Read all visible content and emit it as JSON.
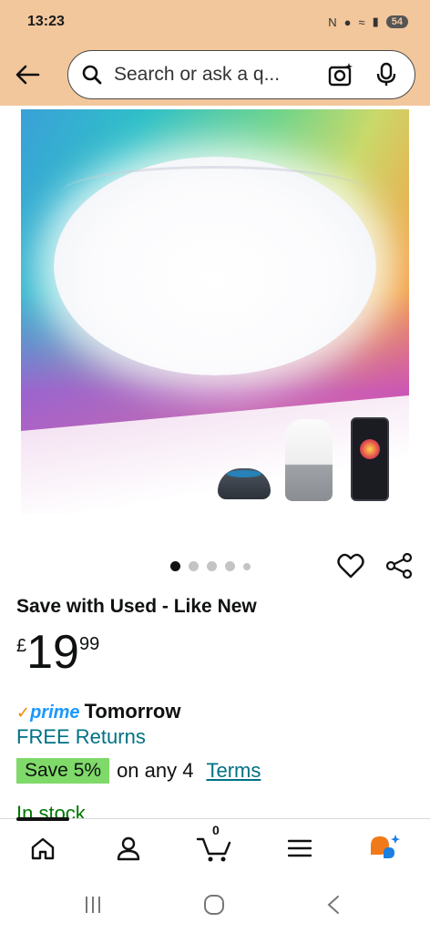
{
  "status": {
    "time": "13:23",
    "battery": "54"
  },
  "search": {
    "placeholder": "Search or ask a q..."
  },
  "carousel": {
    "total_images": 5,
    "active_index": 0
  },
  "product": {
    "condition": "Save with Used - Like New",
    "price": {
      "currency": "£",
      "whole": "19",
      "fraction": "99"
    },
    "delivery": {
      "prime_label": "prime",
      "day": "Tomorrow"
    },
    "returns": "FREE Returns",
    "promo": {
      "badge": "Save 5%",
      "text": "on any 4",
      "terms": "Terms"
    },
    "stock": "In stock"
  },
  "bottom_nav": {
    "cart_count": "0"
  },
  "colors": {
    "header_bg": "#f2c79c",
    "link": "#007185",
    "prime_blue": "#1a98ff",
    "save_badge": "#7fda69",
    "in_stock": "#007600"
  }
}
